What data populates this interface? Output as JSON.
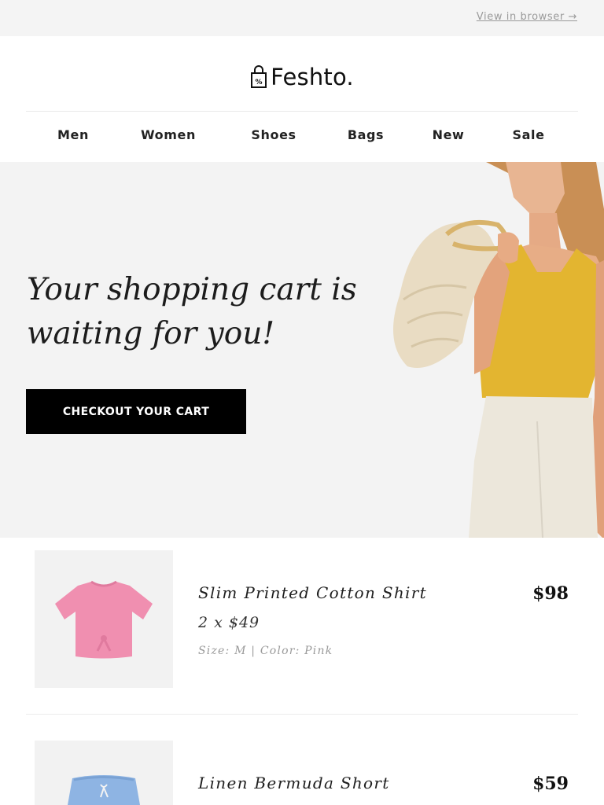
{
  "topbar": {
    "view_in_browser": "View in browser →"
  },
  "brand": {
    "name": "Feshto."
  },
  "nav": {
    "items": [
      "Men",
      "Women",
      "Shoes",
      "Bags",
      "New",
      "Sale"
    ]
  },
  "hero": {
    "headline_line1": "Your shopping cart is",
    "headline_line2": "waiting for you!",
    "cta_label": "CHECKOUT YOUR CART"
  },
  "cart": {
    "items": [
      {
        "name": "Slim Printed Cotton Shirt",
        "quantity_line": "2 x $49",
        "details": "Size: M | Color: Pink",
        "total": "$98",
        "image_icon": "pink-shirt-icon"
      },
      {
        "name": "Linen Bermuda Short",
        "total": "$59",
        "image_icon": "blue-shorts-icon"
      }
    ]
  },
  "colors": {
    "accent": "#000000",
    "hero_bg": "#f3f3f3",
    "page_bg": "#f4f4f4",
    "shirt": "#f08fb0",
    "top": "#e3b530",
    "shorts": "#8eb4e3"
  }
}
